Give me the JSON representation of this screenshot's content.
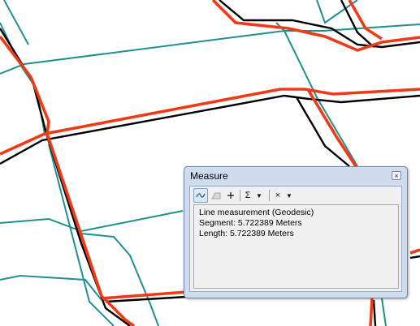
{
  "measure_window": {
    "title": "Measure",
    "close_glyph": "×",
    "toolbar": {
      "measure_line_icon": "measure-line-icon",
      "measure_area_icon": "measure-area-icon",
      "measure_feature_icon": "plus-icon",
      "sum_label": "Σ",
      "dropdown_glyph": "▼",
      "clear_label": "×"
    },
    "results": {
      "line1": "Line measurement (Geodesic)",
      "line2": "Segment: 5.722389 Meters",
      "line3": "Length: 5.722389 Meters"
    }
  },
  "colors": {
    "road_red": "#f03a17",
    "road_black": "#000000",
    "road_teal": "#1f8f8f",
    "window_frame": "#cfdcee"
  }
}
